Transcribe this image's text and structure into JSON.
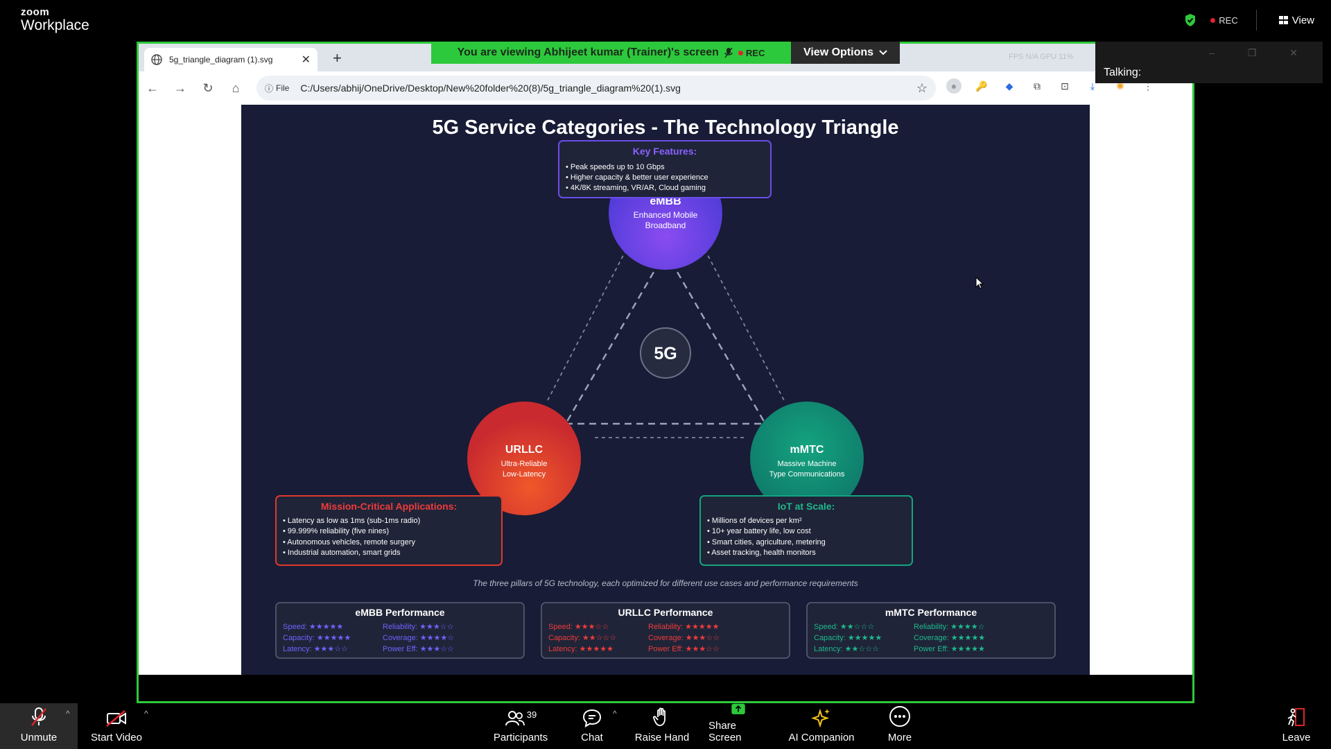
{
  "zoom": {
    "logo_top": "zoom",
    "logo_bottom": "Workplace",
    "rec_label": "REC",
    "view_label": "View",
    "viewing_banner": "You are viewing  Abhijeet kumar (Trainer)'s screen",
    "banner_rec": "REC",
    "view_options": "View Options",
    "talking_label": "Talking:",
    "bottom": {
      "unmute": "Unmute",
      "start_video": "Start Video",
      "participants": "Participants",
      "participants_count": "39",
      "chat": "Chat",
      "raise_hand": "Raise Hand",
      "share_screen": "Share Screen",
      "ai_companion": "AI Companion",
      "more": "More",
      "leave": "Leave"
    }
  },
  "browser": {
    "tab_title": "5g_triangle_diagram (1).svg",
    "fps_text": "FPS  N/A     GPU  11%",
    "file_chip": "File",
    "url": "C:/Users/abhij/OneDrive/Desktop/New%20folder%20(8)/5g_triangle_diagram%20(1).svg"
  },
  "diagram": {
    "title": "5G Service Categories - The Technology Triangle",
    "center_label": "5G",
    "embb": {
      "name": "eMBB",
      "sub1": "Enhanced Mobile",
      "sub2": "Broadband",
      "features_title": "Key Features:",
      "features": [
        "• Peak speeds up to 10 Gbps",
        "• Higher capacity & better user experience",
        "• 4K/8K streaming, VR/AR, Cloud gaming"
      ],
      "color": "#6b3be0"
    },
    "urllc": {
      "name": "URLLC",
      "sub1": "Ultra-Reliable",
      "sub2": "Low-Latency",
      "features_title": "Mission-Critical Applications:",
      "features": [
        "• Latency as low as 1ms (sub-1ms radio)",
        "• 99.999% reliability (five nines)",
        "• Autonomous vehicles, remote surgery",
        "• Industrial automation, smart grids"
      ],
      "color": "#e0392b"
    },
    "mmtc": {
      "name": "mMTC",
      "sub1": "Massive Machine",
      "sub2": "Type Communications",
      "features_title": "IoT at Scale:",
      "features": [
        "• Millions of devices per km²",
        "• 10+ year battery life, low cost",
        "• Smart cities, agriculture, metering",
        "• Asset tracking, health monitors"
      ],
      "color": "#14a37f"
    },
    "caption": "The three pillars of 5G technology, each optimized for different use cases and performance requirements",
    "perf": [
      {
        "title": "eMBB Performance",
        "color": "#6e63ff",
        "rows": [
          [
            "Speed: ★★★★★",
            "Reliability: ★★★☆☆"
          ],
          [
            "Capacity: ★★★★★",
            "Coverage: ★★★★☆"
          ],
          [
            "Latency: ★★★☆☆",
            "Power Eff: ★★★☆☆"
          ]
        ]
      },
      {
        "title": "URLLC Performance",
        "color": "#ef3b3b",
        "rows": [
          [
            "Speed: ★★★☆☆",
            "Reliability: ★★★★★"
          ],
          [
            "Capacity: ★★☆☆☆",
            "Coverage: ★★★☆☆"
          ],
          [
            "Latency: ★★★★★",
            "Power Eff: ★★★☆☆"
          ]
        ]
      },
      {
        "title": "mMTC Performance",
        "color": "#1fb98c",
        "rows": [
          [
            "Speed: ★★☆☆☆",
            "Reliability: ★★★★☆"
          ],
          [
            "Capacity: ★★★★★",
            "Coverage: ★★★★★"
          ],
          [
            "Latency: ★★☆☆☆",
            "Power Eff: ★★★★★"
          ]
        ]
      }
    ]
  }
}
